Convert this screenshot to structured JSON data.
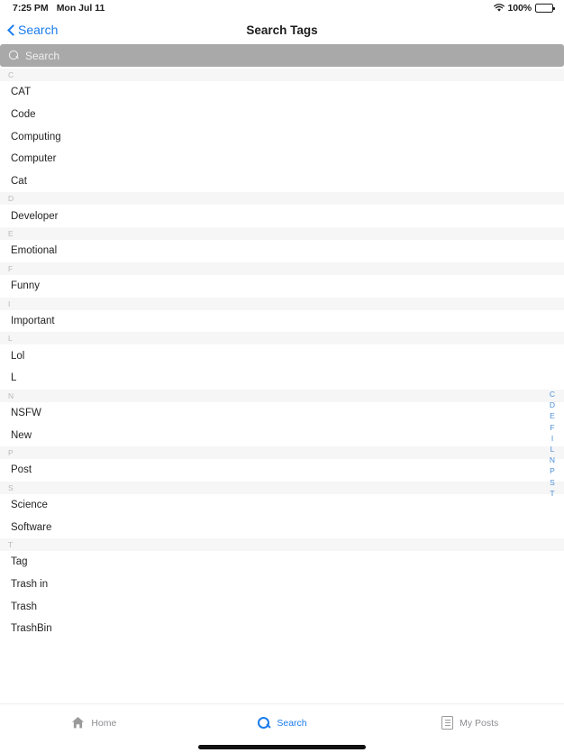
{
  "status_bar": {
    "time": "7:25 PM",
    "date": "Mon Jul 11",
    "wifi_icon": "wifi-icon",
    "battery_percent": "100%",
    "battery_icon": "battery-full-icon"
  },
  "nav_bar": {
    "back_icon": "chevron-left-icon",
    "back_label": "Search",
    "title": "Search Tags"
  },
  "search": {
    "icon": "search-icon",
    "placeholder": "Search",
    "value": ""
  },
  "sections": [
    {
      "letter": "C",
      "items": [
        "CAT",
        "Code",
        "Computing",
        "Computer",
        "Cat"
      ]
    },
    {
      "letter": "D",
      "items": [
        "Developer"
      ]
    },
    {
      "letter": "E",
      "items": [
        "Emotional"
      ]
    },
    {
      "letter": "F",
      "items": [
        "Funny"
      ]
    },
    {
      "letter": "I",
      "items": [
        "Important"
      ]
    },
    {
      "letter": "L",
      "items": [
        "Lol",
        "L"
      ]
    },
    {
      "letter": "N",
      "items": [
        "NSFW",
        "New"
      ]
    },
    {
      "letter": "P",
      "items": [
        "Post"
      ]
    },
    {
      "letter": "S",
      "items": [
        "Science",
        "Software"
      ]
    },
    {
      "letter": "T",
      "items": [
        "Tag",
        "Trash in",
        "Trash",
        "TrashBin"
      ]
    }
  ],
  "index_bar": [
    "C",
    "D",
    "E",
    "F",
    "I",
    "L",
    "N",
    "P",
    "S",
    "T"
  ],
  "tab_bar": {
    "tabs": [
      {
        "label": "Home",
        "icon": "home-icon",
        "active": false
      },
      {
        "label": "Search",
        "icon": "search-icon",
        "active": true
      },
      {
        "label": "My Posts",
        "icon": "document-list-icon",
        "active": false
      }
    ]
  },
  "colors": {
    "accent": "#1a7ced",
    "index_letter": "#4b8fd6",
    "search_field_bg": "#a9a9a9",
    "section_header_bg": "#f6f6f6",
    "inactive_tab": "#8e8e93"
  }
}
